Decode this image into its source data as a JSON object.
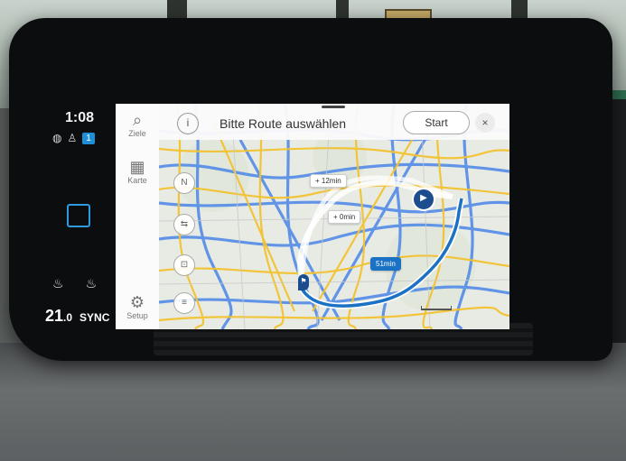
{
  "left_panel": {
    "clock": "1:08",
    "status_badge": "1",
    "temperature": "21",
    "temperature_decimal": ".0",
    "sync_label": "SYNC"
  },
  "side_menu": {
    "items": [
      {
        "label": "Ziele",
        "icon": "search-icon"
      },
      {
        "label": "Karte",
        "icon": "map-icon"
      },
      {
        "label": "Setup",
        "icon": "gear-icon"
      }
    ]
  },
  "nav": {
    "title": "Bitte Route auswählen",
    "start_label": "Start",
    "info_glyph": "i",
    "close_glyph": "×",
    "compass_label": "N",
    "routes": [
      {
        "label": "+ 12min"
      },
      {
        "label": "+ 0min"
      },
      {
        "label": "51min"
      }
    ]
  },
  "colors": {
    "accent_blue": "#1ea2e6",
    "route_main": "#1b72c4",
    "map_road_yellow": "#f2c230",
    "map_road_blue": "#3d7be0"
  }
}
